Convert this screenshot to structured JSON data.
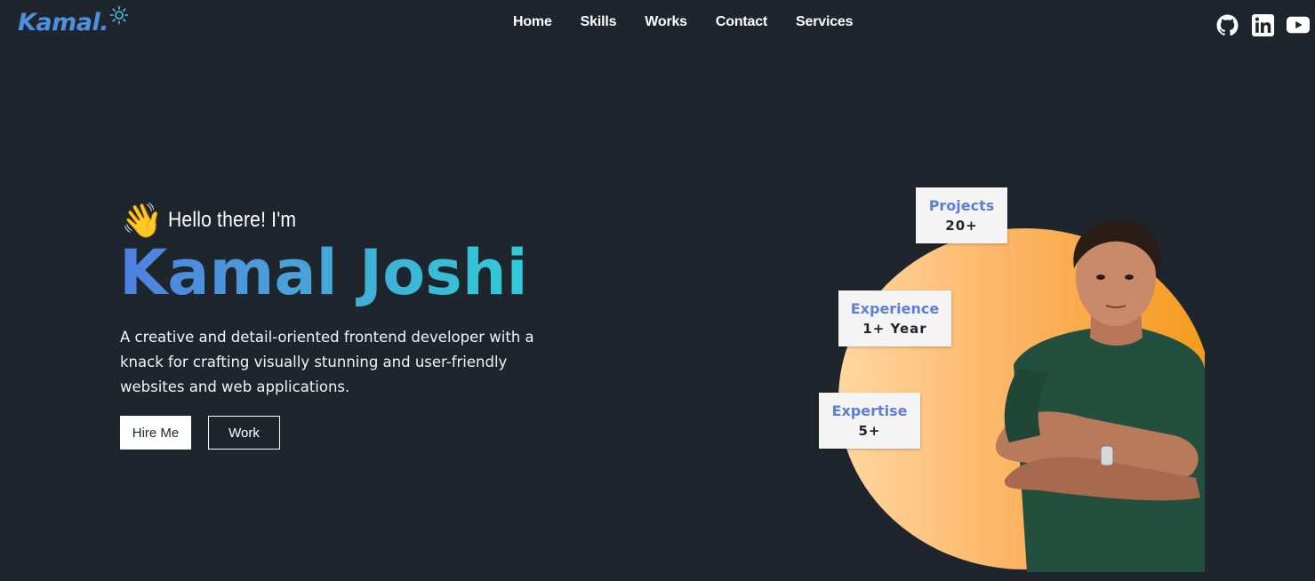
{
  "header": {
    "logo_text": "Kamal.",
    "nav": [
      "Home",
      "Skills",
      "Works",
      "Contact",
      "Services"
    ],
    "social_icons": [
      "github-icon",
      "linkedin-icon",
      "youtube-icon"
    ]
  },
  "hero": {
    "wave_emoji": "👋",
    "greeting": "Hello there! I'm",
    "name": "Kamal Joshi",
    "description": "A creative and detail-oriented frontend developer with a knack for crafting visually stunning and user-friendly websites and web applications.",
    "buttons": {
      "hire": "Hire Me",
      "work": "Work"
    }
  },
  "stats": {
    "projects": {
      "label": "Projects",
      "value": "20+"
    },
    "experience": {
      "label": "Experience",
      "value": "1+ Year"
    },
    "expertise": {
      "label": "Expertise",
      "value": "5+"
    }
  },
  "colors": {
    "background": "#1f252d",
    "accent_blue": "#4f7fe0",
    "accent_cyan": "#31cbd6",
    "orange": "#f59a1b"
  }
}
